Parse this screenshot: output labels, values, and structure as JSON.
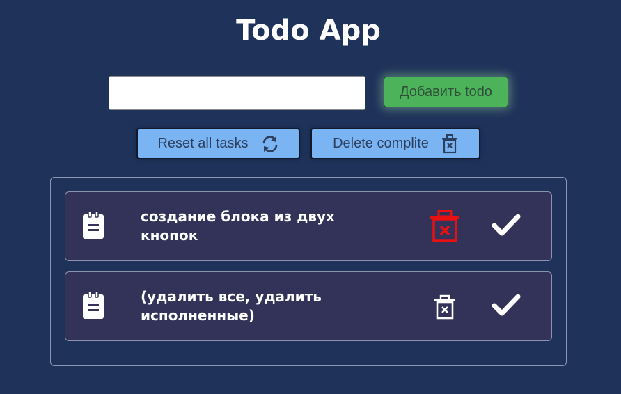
{
  "app": {
    "title": "Todo App"
  },
  "form": {
    "input_value": "",
    "input_placeholder": "",
    "add_label": "Добавить todo"
  },
  "controls": {
    "reset_label": "Reset all tasks",
    "delete_label": "Delete complite"
  },
  "todos": [
    {
      "text": "создание блока из двух кнопок",
      "trash_color": "#e81010",
      "trash_hovered": true
    },
    {
      "text": "(удалить все, удалить исполненные)",
      "trash_color": "#ffffff",
      "trash_hovered": false
    }
  ],
  "colors": {
    "background": "#1f325a",
    "add_button": "#4cb35b",
    "control_button": "#7ab4f3",
    "todo_item": "#33335a",
    "trash_active": "#e81010"
  },
  "icons": {
    "reset": "refresh-icon",
    "delete": "trash-x-icon",
    "note": "clipboard-icon",
    "trash": "trash-x-icon",
    "check": "check-icon"
  }
}
